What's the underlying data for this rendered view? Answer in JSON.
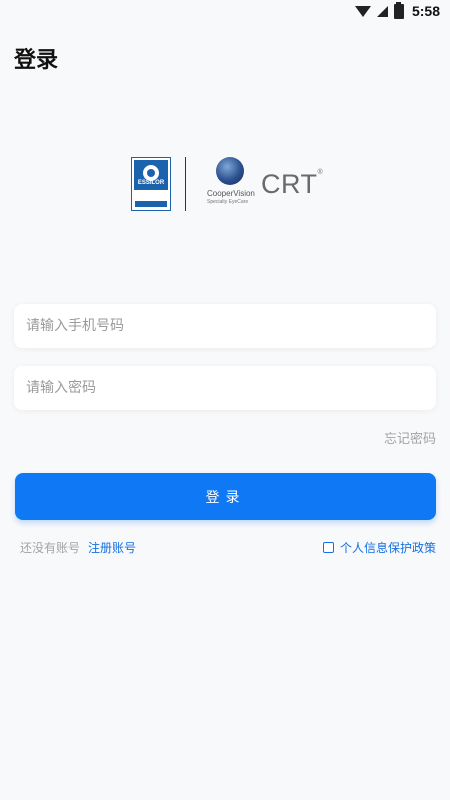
{
  "status_bar": {
    "time": "5:58",
    "icons": [
      "wifi-icon",
      "signal-icon",
      "battery-icon"
    ]
  },
  "page": {
    "title": "登录"
  },
  "logo": {
    "essilor_text": "ESSILOR",
    "coopervision_text": "CooperVision",
    "coopervision_sub": "Specialty EyeCare",
    "crt_text": "CRT",
    "crt_mark": "®"
  },
  "form": {
    "phone_placeholder": "请输入手机号码",
    "phone_value": "",
    "password_placeholder": "请输入密码",
    "password_value": "",
    "forgot_label": "忘记密码",
    "login_label": "登录"
  },
  "footer": {
    "no_account_label": "还没有账号",
    "register_label": "注册账号",
    "policy_label": "个人信息保护政策",
    "policy_checked": false
  },
  "colors": {
    "primary": "#0f79f5",
    "link": "#1570e0",
    "muted": "#a3a3a3",
    "background": "#f8f9fb"
  }
}
